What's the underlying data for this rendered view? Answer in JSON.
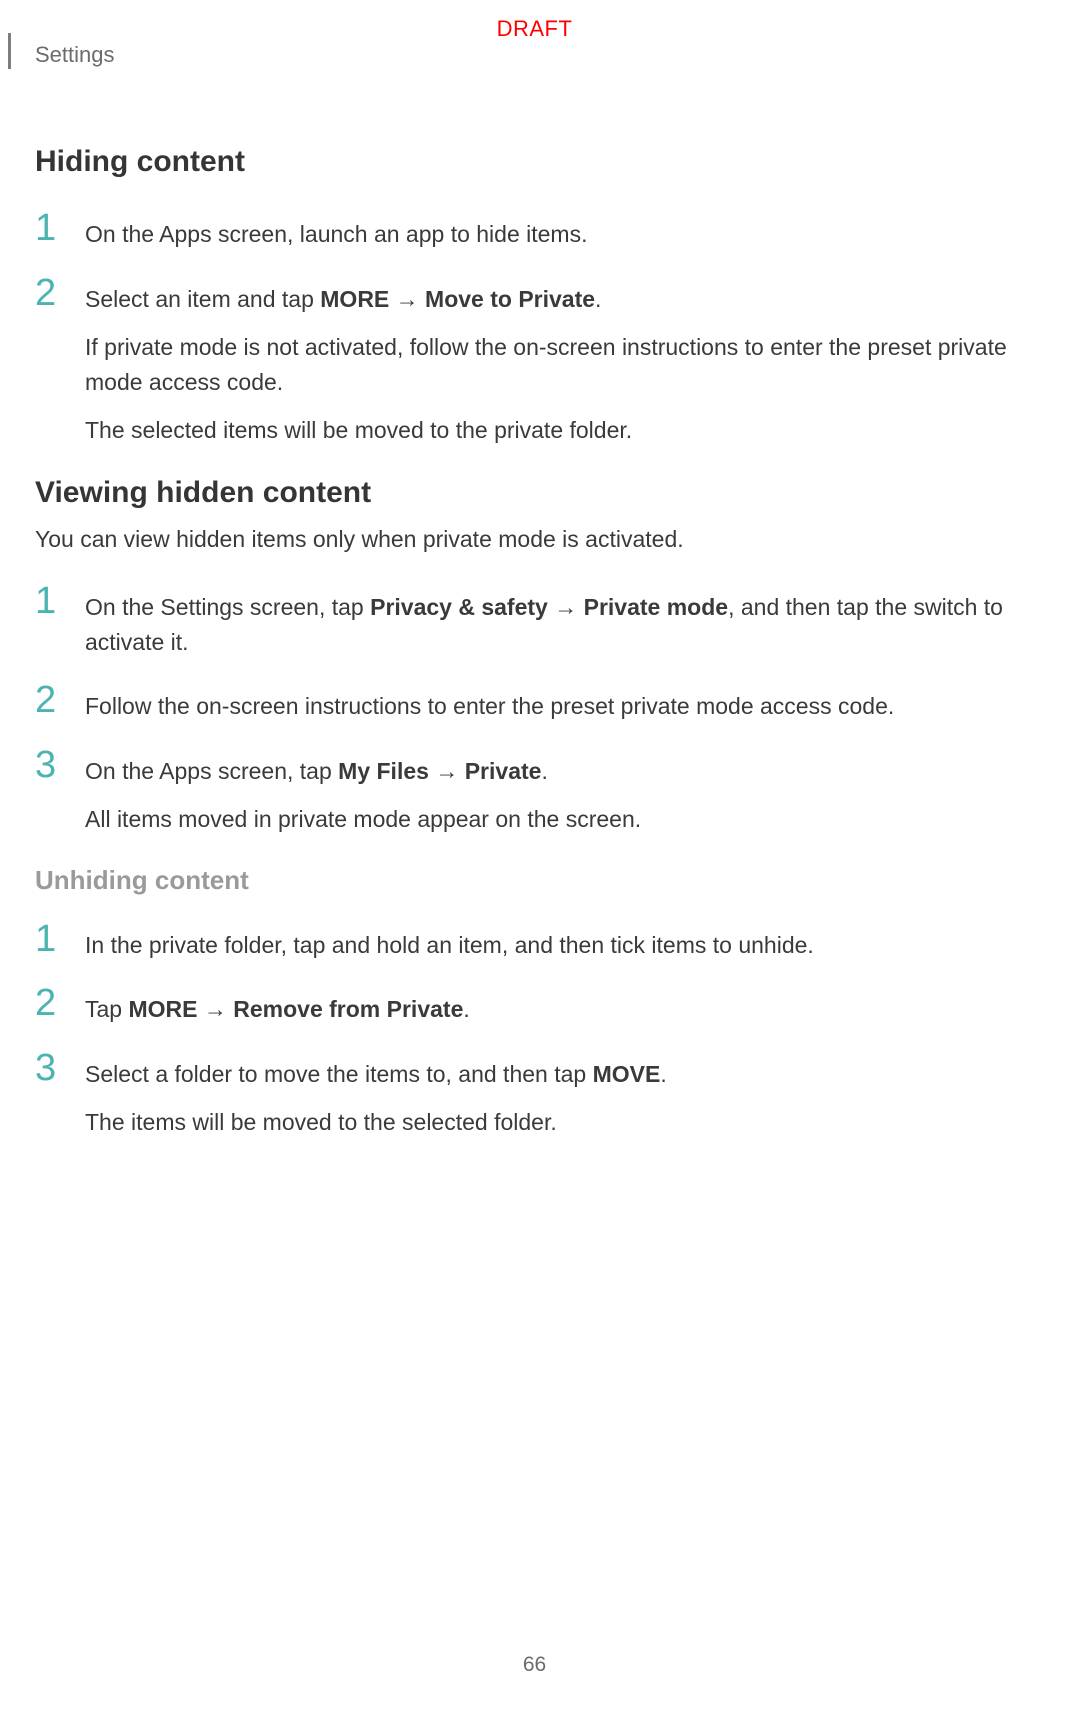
{
  "header": {
    "section": "Settings",
    "watermark": "DRAFT"
  },
  "section1": {
    "title": "Hiding content",
    "step1": {
      "num": "1",
      "text": "On the Apps screen, launch an app to hide items."
    },
    "step2": {
      "num": "2",
      "lead": "Select an item and tap ",
      "b1": "MORE",
      "arrow": " → ",
      "b2": "Move to Private",
      "period": ".",
      "p2": "If private mode is not activated, follow the on-screen instructions to enter the preset private mode access code.",
      "p3": "The selected items will be moved to the private folder."
    }
  },
  "section2": {
    "title": "Viewing hidden content",
    "intro": "You can view hidden items only when private mode is activated.",
    "step1": {
      "num": "1",
      "lead": "On the Settings screen, tap ",
      "b1": "Privacy & safety",
      "arrow": " → ",
      "b2": "Private mode",
      "trail": ", and then tap the switch to activate it."
    },
    "step2": {
      "num": "2",
      "text": "Follow the on-screen instructions to enter the preset private mode access code."
    },
    "step3": {
      "num": "3",
      "lead": "On the Apps screen, tap ",
      "b1": "My Files",
      "arrow": " → ",
      "b2": "Private",
      "period": ".",
      "p2": "All items moved in private mode appear on the screen."
    }
  },
  "section3": {
    "title": "Unhiding content",
    "step1": {
      "num": "1",
      "text": "In the private folder, tap and hold an item, and then tick items to unhide."
    },
    "step2": {
      "num": "2",
      "lead": "Tap ",
      "b1": "MORE",
      "arrow": " → ",
      "b2": "Remove from Private",
      "period": "."
    },
    "step3": {
      "num": "3",
      "lead": "Select a folder to move the items to, and then tap ",
      "b1": "MOVE",
      "period": ".",
      "p2": "The items will be moved to the selected folder."
    }
  },
  "page_number": "66"
}
